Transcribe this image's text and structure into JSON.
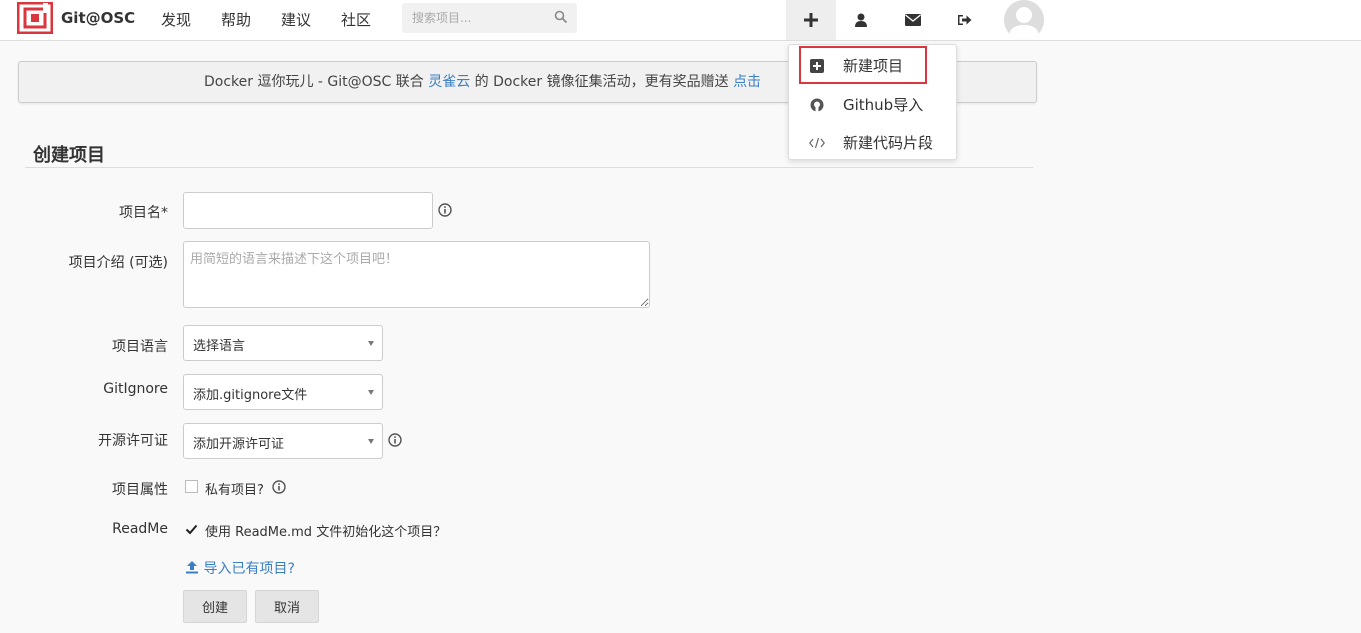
{
  "navbar": {
    "brand": "Git@OSC",
    "links": [
      "发现",
      "帮助",
      "建议",
      "社区"
    ],
    "search_placeholder": "搜索项目...",
    "brand_color": "#d9363e"
  },
  "banner": {
    "text_before": "Docker 逗你玩儿 - Git@OSC 联合 ",
    "link1": "灵雀云",
    "text_middle": " 的 Docker 镜像征集活动，更有奖品赠送 ",
    "link2": "点击"
  },
  "dropdown": {
    "items": [
      "新建项目",
      "Github导入",
      "新建代码片段"
    ]
  },
  "form": {
    "title": "创建项目",
    "name_label": "项目名*",
    "desc_label": "项目介绍 (可选)",
    "desc_placeholder": "用简短的语言来描述下这个项目吧！",
    "language_label": "项目语言",
    "language_value": "选择语言",
    "gitignore_label": "GitIgnore",
    "gitignore_value": "添加.gitignore文件",
    "license_label": "开源许可证",
    "license_value": "添加开源许可证",
    "property_label": "项目属性",
    "private_label": "私有项目?",
    "readme_label": "ReadMe",
    "readme_text": "使用 ReadMe.md 文件初始化这个项目？",
    "import_link": "导入已有项目?",
    "create_button": "创建",
    "cancel_button": "取消"
  }
}
